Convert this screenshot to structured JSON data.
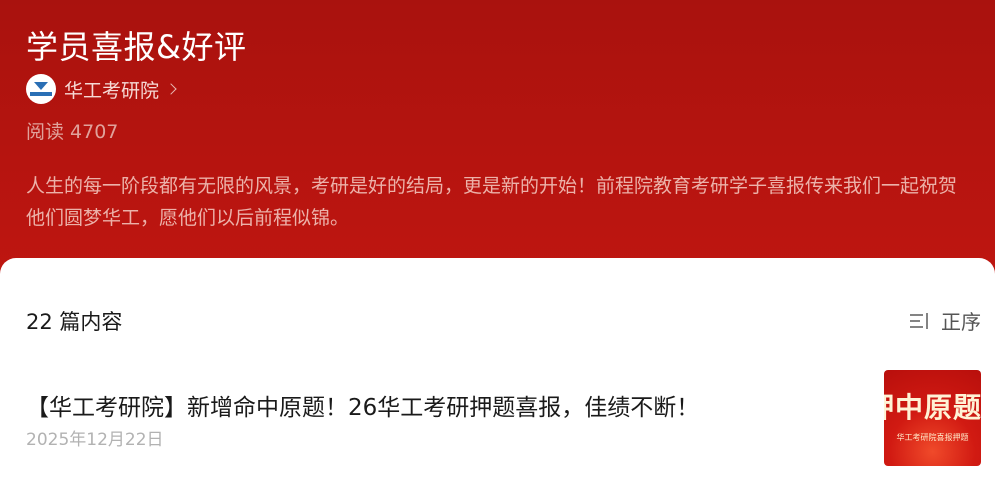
{
  "header": {
    "title": "学员喜报&好评",
    "author": {
      "name": "华工考研院",
      "avatar_icon": "school-logo-icon"
    },
    "reads": "阅读 4707",
    "description": "人生的每一阶段都有无限的风景，考研是好的结局，更是新的开始！前程院教育考研学子喜报传来我们一起祝贺他们圆梦华工，愿他们以后前程似锦。"
  },
  "list": {
    "count_label": "22 篇内容",
    "sort_label": "正序",
    "sort_icon": "sort-icon"
  },
  "articles": [
    {
      "title": "【华工考研院】新增命中原题！26华工考研押题喜报，佳绩不断！",
      "date": "2025年12月22日",
      "thumb_big": "押中原题",
      "thumb_small": "华工考研院喜报押题"
    }
  ],
  "colors": {
    "hero_bg": "#b5140f",
    "accent_text": "#ecb1a9"
  }
}
